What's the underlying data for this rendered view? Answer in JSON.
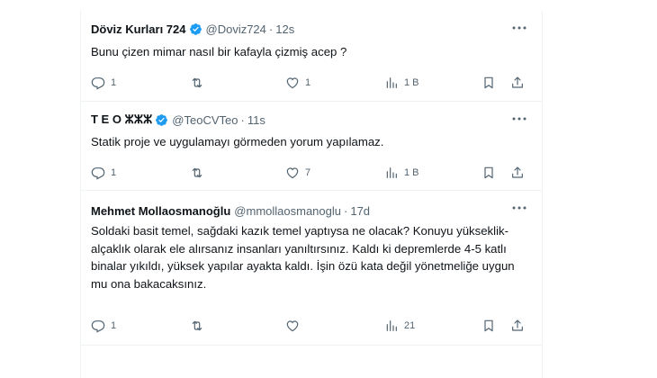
{
  "tweets": [
    {
      "name": "Döviz Kurları 724",
      "handle": "@Doviz724",
      "separator": "·",
      "time": "12s",
      "text": "Bunu çizen mimar nasıl bir kafayla çizmiş acep ?",
      "replies": "1",
      "retweets": "",
      "likes": "1",
      "views": "1 B"
    },
    {
      "name": "T E O ⵣⵣⵣ",
      "handle": "@TeoCVTeo",
      "separator": "·",
      "time": "11s",
      "text": "Statik proje ve uygulamayı görmeden yorum yapılamaz.",
      "replies": "1",
      "retweets": "",
      "likes": "7",
      "views": "1 B"
    },
    {
      "name": "Mehmet Mollaosmanoğlu",
      "handle": "@mmollaosmanoglu",
      "separator": "·",
      "time": "17d",
      "text": "Soldaki basit temel, sağdaki kazık temel yaptıysa ne olacak? Konuyu yükseklik-alçaklık olarak ele alırsanız insanları yanıltırsınız. Kaldı ki depremlerde 4-5 katlı binalar yıkıldı, yüksek yapılar ayakta kaldı. İşin özü kata değil yönetmeliğe uygun mu ona bakacaksınız.",
      "replies": "1",
      "retweets": "",
      "likes": "",
      "views": "21"
    }
  ],
  "colors": {
    "verified": "#1d9bf0",
    "muted": "#536471",
    "text": "#0f1419",
    "divider": "#eff3f4"
  },
  "icons": [
    "verified-badge-icon",
    "more-icon",
    "reply-icon",
    "retweet-icon",
    "like-icon",
    "views-icon",
    "bookmark-icon",
    "share-icon"
  ]
}
